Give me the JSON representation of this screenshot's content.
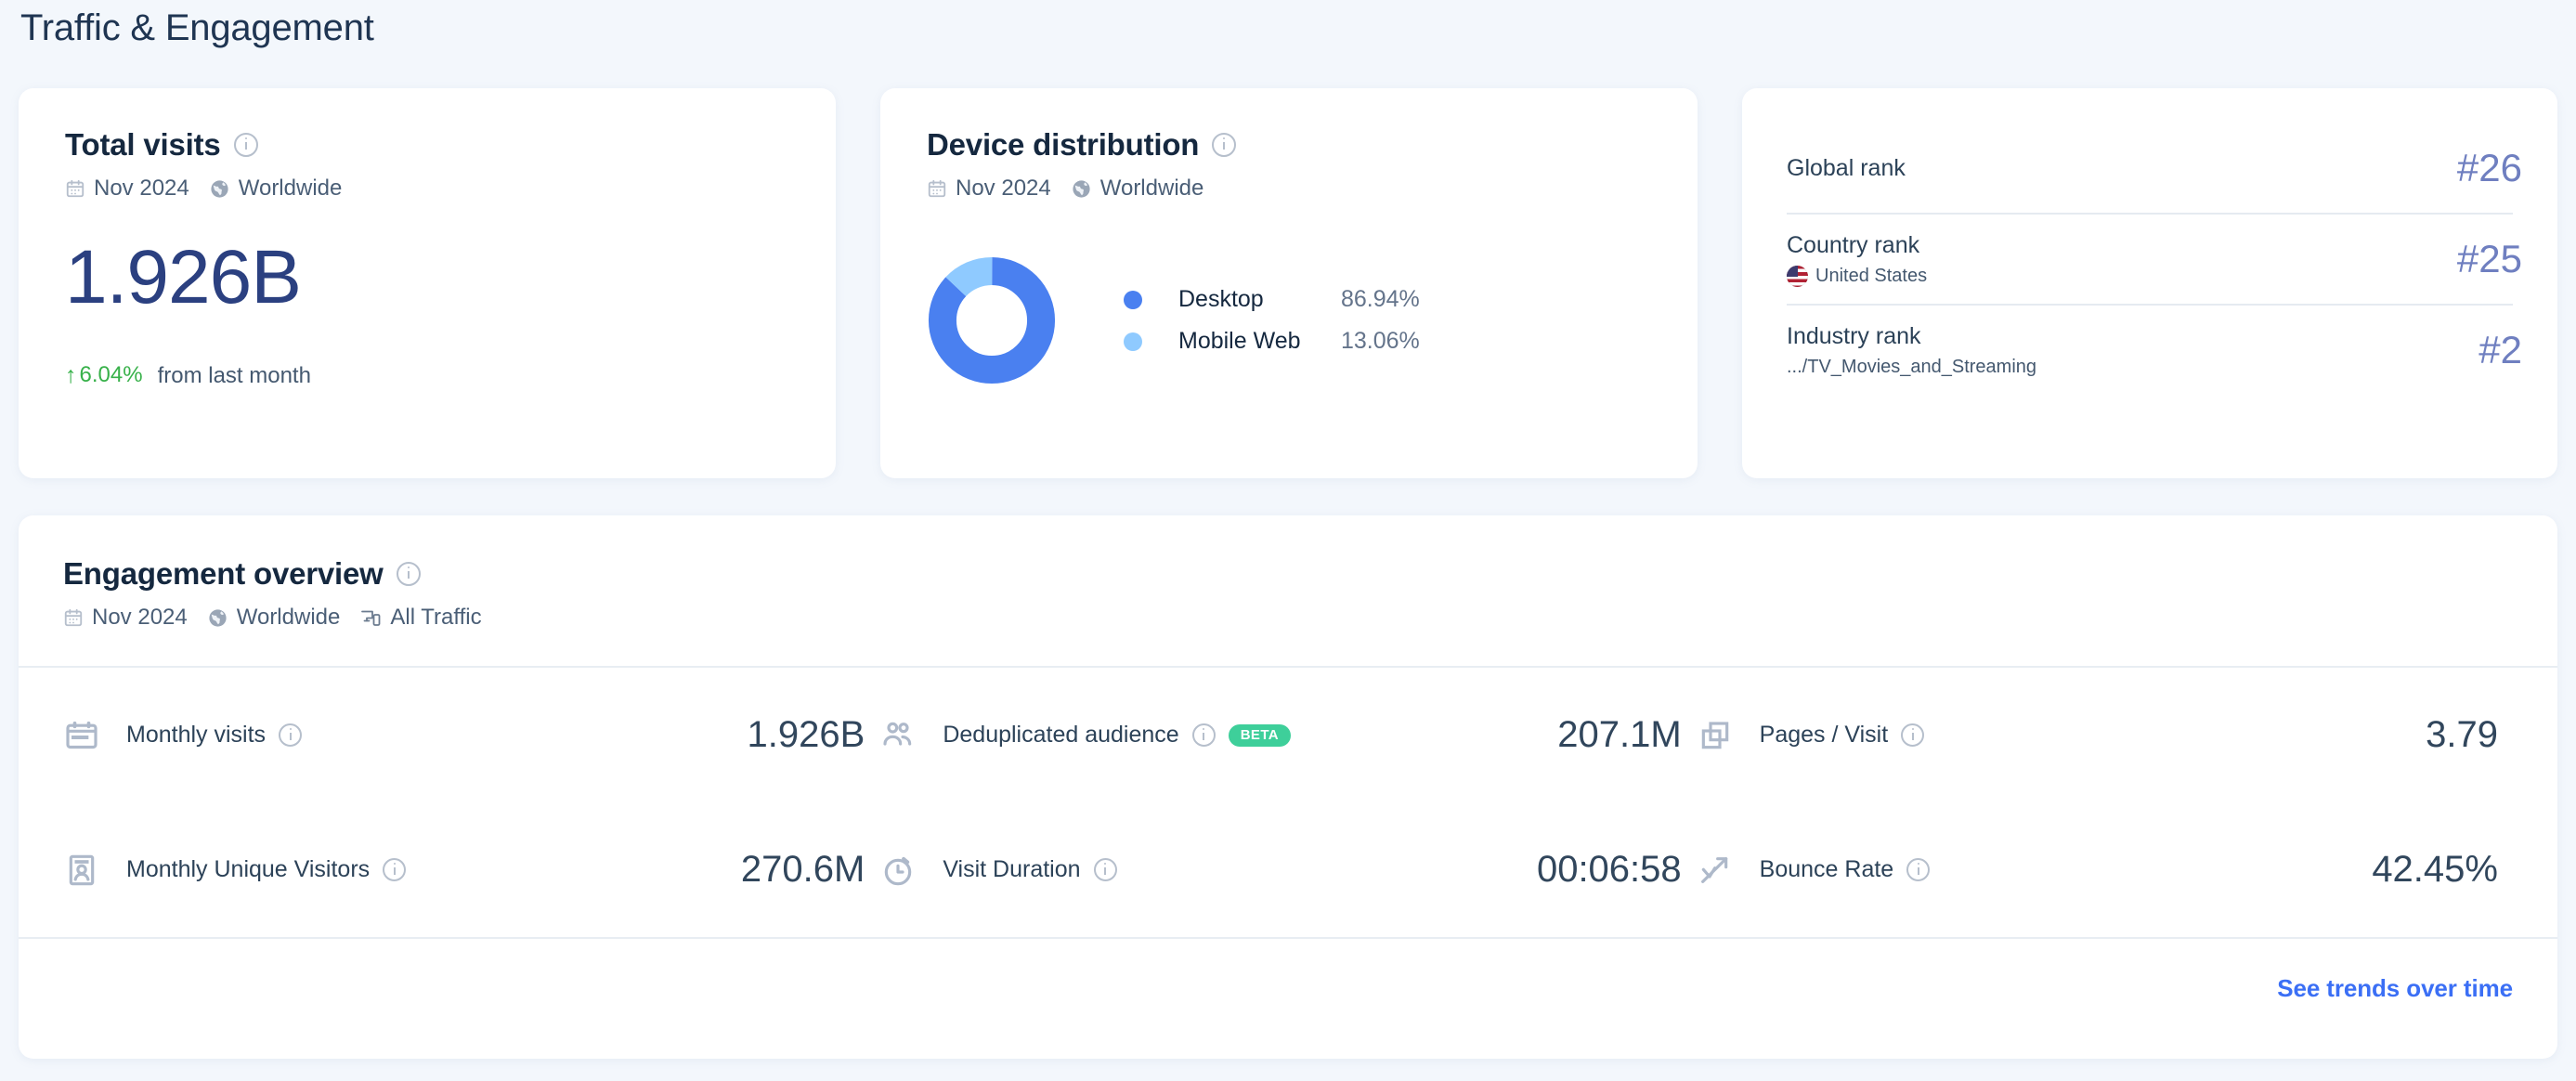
{
  "page": {
    "title": "Traffic & Engagement",
    "background_color": "#f3f7fc"
  },
  "total_visits": {
    "title": "Total visits",
    "info_icon": "info-icon",
    "calendar_icon": "calendar-icon",
    "period": "Nov 2024",
    "globe_icon": "globe-icon",
    "region": "Worldwide",
    "value": "1.926B",
    "delta_arrow": "↑",
    "delta_value": "6.04%",
    "delta_label": "from last month",
    "delta_color": "#38b14a",
    "value_color": "#2b4080"
  },
  "device_distribution": {
    "title": "Device distribution",
    "info_icon": "info-icon",
    "calendar_icon": "calendar-icon",
    "period": "Nov 2024",
    "globe_icon": "globe-icon",
    "region": "Worldwide",
    "legend": [
      {
        "label": "Desktop",
        "value": "86.94%",
        "color": "#4a80f0"
      },
      {
        "label": "Mobile Web",
        "value": "13.06%",
        "color": "#8fcaff"
      }
    ]
  },
  "chart_data": {
    "type": "pie",
    "title": "Device distribution",
    "subtitle": "Nov 2024 · Worldwide",
    "categories": [
      "Desktop",
      "Mobile Web"
    ],
    "values": [
      86.94,
      13.06
    ],
    "colors": [
      "#4a80f0",
      "#8fcaff"
    ],
    "unit": "%",
    "donut": true,
    "inner_radius_ratio": 0.56,
    "start_angle_deg": 0,
    "direction": "clockwise",
    "legend_position": "right",
    "grid": false
  },
  "ranks": {
    "rows": [
      {
        "label": "Global rank",
        "meta": "",
        "flag": "",
        "value": "#26"
      },
      {
        "label": "Country rank",
        "meta": "United States",
        "flag": "us-flag-icon",
        "value": "#25"
      },
      {
        "label": "Industry rank",
        "meta": ".../TV_Movies_and_Streaming",
        "flag": "",
        "value": "#2"
      }
    ],
    "value_color": "#6f7fc0"
  },
  "engagement": {
    "title": "Engagement overview",
    "info_icon": "info-icon",
    "calendar_icon": "calendar-icon",
    "period": "Nov 2024",
    "globe_icon": "globe-icon",
    "region": "Worldwide",
    "devices_icon": "devices-icon",
    "traffic": "All Traffic",
    "metrics": [
      {
        "icon": "monthly-visits-icon",
        "label": "Monthly visits",
        "value": "1.926B",
        "badge": ""
      },
      {
        "icon": "deduplicated-audience-icon",
        "label": "Deduplicated audience",
        "value": "207.1M",
        "badge": "BETA"
      },
      {
        "icon": "pages-per-visit-icon",
        "label": "Pages / Visit",
        "value": "3.79",
        "badge": ""
      },
      {
        "icon": "monthly-unique-visitors-icon",
        "label": "Monthly Unique Visitors",
        "value": "270.6M",
        "badge": ""
      },
      {
        "icon": "visit-duration-icon",
        "label": "Visit Duration",
        "value": "00:06:58",
        "badge": ""
      },
      {
        "icon": "bounce-rate-icon",
        "label": "Bounce Rate",
        "value": "42.45%",
        "badge": ""
      }
    ],
    "badge_color": "#3ecf9a",
    "trends_link": "See trends over time",
    "link_color": "#3b6ff5"
  }
}
